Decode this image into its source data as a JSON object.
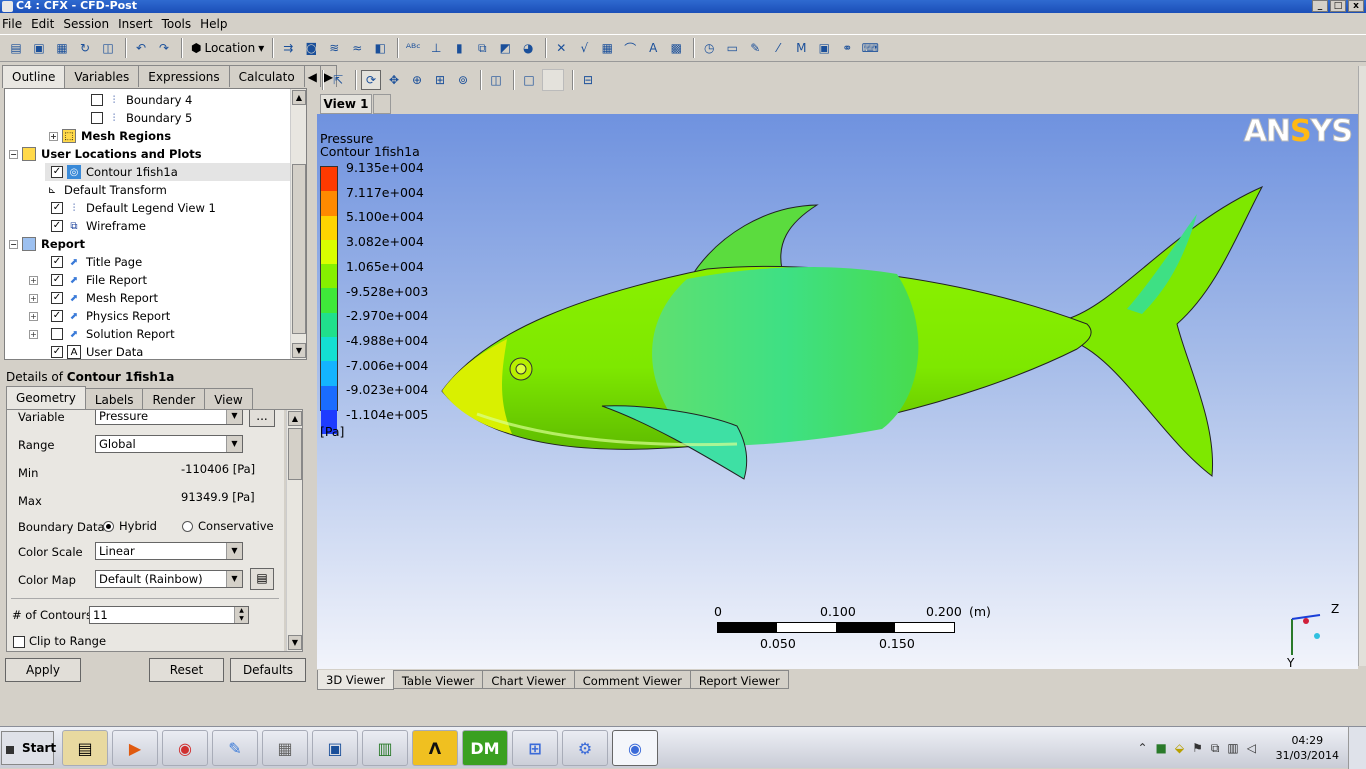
{
  "window": {
    "title": "C4 : CFX - CFD-Post",
    "minimize": "_",
    "maximize": "□",
    "close": "x"
  },
  "menu": [
    "File",
    "Edit",
    "Session",
    "Insert",
    "Tools",
    "Help"
  ],
  "toolbar": {
    "location_label": "Location"
  },
  "outline_tabs": [
    "Outline",
    "Variables",
    "Expressions",
    "Calculato"
  ],
  "tree": {
    "boundary4": "Boundary 4",
    "boundary5": "Boundary 5",
    "mesh_regions": "Mesh Regions",
    "user_locations": "User Locations and Plots",
    "contour": "Contour 1fish1a",
    "default_transform": "Default Transform",
    "default_legend": "Default Legend View 1",
    "wireframe": "Wireframe",
    "report": "Report",
    "title_page": "Title Page",
    "file_report": "File Report",
    "mesh_report": "Mesh Report",
    "physics_report": "Physics Report",
    "solution_report": "Solution Report",
    "user_data": "User Data"
  },
  "details": {
    "title_prefix": "Details of ",
    "title_name": "Contour 1fish1a",
    "tabs": [
      "Geometry",
      "Labels",
      "Render",
      "View"
    ],
    "variable_label": "Variable",
    "variable_value": "Pressure",
    "range_label": "Range",
    "range_value": "Global",
    "min_label": "Min",
    "min_value": "-110406 [Pa]",
    "max_label": "Max",
    "max_value": "91349.9 [Pa]",
    "boundary_label": "Boundary Data",
    "boundary_hybrid": "Hybrid",
    "boundary_conservative": "Conservative",
    "color_scale_label": "Color Scale",
    "color_scale_value": "Linear",
    "color_map_label": "Color Map",
    "color_map_value": "Default (Rainbow)",
    "contours_label": "# of Contours",
    "contours_value": "11",
    "clip_label": "Clip to Range",
    "browse": "..."
  },
  "buttons": {
    "apply": "Apply",
    "reset": "Reset",
    "defaults": "Defaults"
  },
  "view_tab": "View 1",
  "legend": {
    "title": "Pressure",
    "subtitle": "Contour 1fish1a",
    "ticks": [
      "9.135e+004",
      "7.117e+004",
      "5.100e+004",
      "3.082e+004",
      "1.065e+004",
      "-9.528e+003",
      "-2.970e+004",
      "-4.988e+004",
      "-7.006e+004",
      "-9.023e+004",
      "-1.104e+005"
    ],
    "unit": "[Pa]",
    "colors": [
      "#ff3a00",
      "#ff8a00",
      "#ffd400",
      "#d9ff00",
      "#86f000",
      "#3fe83a",
      "#20e08c",
      "#14e0d2",
      "#14b4ff",
      "#1a6cff",
      "#1e3cff"
    ]
  },
  "logo": {
    "text_pre": "AN",
    "text_accent": "S",
    "text_post": "YS"
  },
  "scale": {
    "top_labels": [
      "0",
      "0.100",
      "0.200"
    ],
    "unit": "(m)",
    "bottom_labels": [
      "0.050",
      "0.150"
    ]
  },
  "axis": {
    "z": "Z",
    "y": "Y"
  },
  "bottom_tabs": [
    "3D Viewer",
    "Table Viewer",
    "Chart Viewer",
    "Comment Viewer",
    "Report Viewer"
  ],
  "taskbar": {
    "start": "Start",
    "time": "04:29",
    "date": "31/03/2014"
  },
  "colors": {
    "fish_green": "#7ee800",
    "fish_light": "#3ee084",
    "sky_top": "#6f92df"
  }
}
